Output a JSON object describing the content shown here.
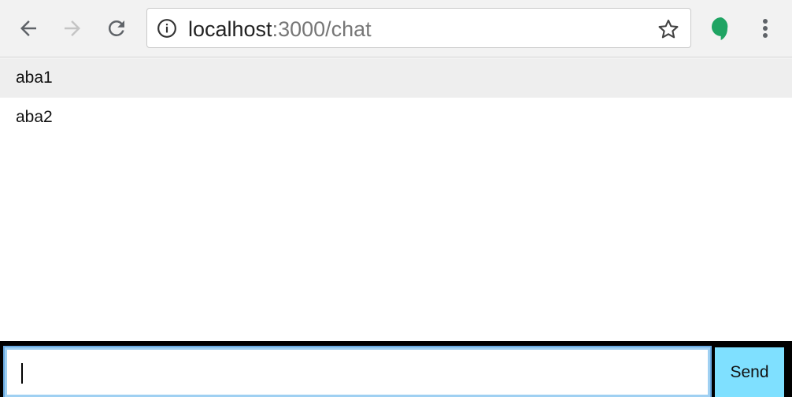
{
  "browser": {
    "url_host": "localhost",
    "url_rest": ":3000/chat",
    "icons": {
      "back": "arrow-left-icon",
      "forward": "arrow-right-icon",
      "reload": "reload-icon",
      "info": "info-icon",
      "star": "star-icon",
      "extension": "hangouts-icon",
      "menu": "more-vert-icon"
    },
    "colors": {
      "extension": "#1fa463"
    }
  },
  "messages": [
    "aba1",
    "aba2"
  ],
  "composer": {
    "input_value": "",
    "send_label": "Send",
    "colors": {
      "send_bg": "#7fe0ff",
      "background": "#000000"
    }
  }
}
